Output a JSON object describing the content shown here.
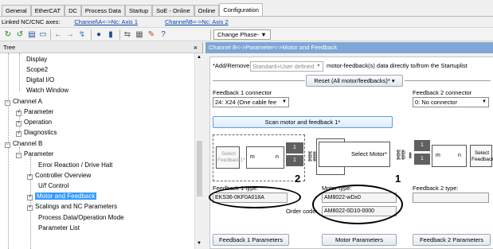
{
  "tabs": [
    "General",
    "EtherCAT",
    "DC",
    "Process Data",
    "Startup",
    "SoE - Online",
    "Online",
    "Configuration"
  ],
  "linked": {
    "label": "Linked NC/CNC axes:",
    "link1": "Channel\\A<->Nc: Axis 1",
    "link2": "Channel\\B<->Nc: Axis 2"
  },
  "toolbar": {
    "phase": "Change Phase-",
    "phase_arrow": "▼"
  },
  "tree": {
    "title": "Tree",
    "close": "×",
    "items": [
      "Display",
      "Scope2",
      "Digital I/O",
      "Watch Window",
      "Channel A",
      "Parameter",
      "Operation",
      "Diagnostics",
      "Channel B",
      "Parameter",
      "Error Reaction / Drive Halt",
      "Controller Overview",
      "U/f Control",
      "Motor and Feedback",
      "Scalings and NC Parameters",
      "Process Data/Operation Mode",
      "Parameter List"
    ],
    "expand": [
      "−",
      "+",
      "+",
      "+",
      "−",
      "−",
      "+",
      "+",
      "+"
    ]
  },
  "panel": {
    "header": "Channel B<->Parameter<->Motor and Feedback",
    "add_remove_label": "*Add/Remove",
    "add_remove_value": "Standard+User defined",
    "add_remove_text": "motor-feedback(s) data directly to/from the Startuplist",
    "reset": "Reset (All motor/feedbacks)*",
    "fb1_label": "Feedback 1 connector",
    "fb1_value": "24: X24 (One cable fee",
    "fb2_label": "Feedback 2 connector",
    "fb2_value": "0: No connector",
    "scan": "Scan motor and feedback 1*",
    "select_fb1": "Select Feedback1*",
    "select_motor": "Select Motor*",
    "select_fb2": "Select Feedback2*",
    "m": "m",
    "n": "n",
    "one": "1",
    "fb1_type_label": "Feedback 1 type:",
    "fb1_type_value": "EKS36-0KF0A018A",
    "motor_type_label": "Motor type:",
    "motor_type_value": "AM8022-wDx0",
    "fb2_type_label": "Feedback 2 type:",
    "order_code_label": "Order code:",
    "order_code_value": "AM8022-0D10-0000",
    "fb1_params": "Feedback 1 Parameters",
    "motor_params": "Motor Parameters",
    "fb2_params": "Feedback 2 Parameters",
    "annot1": "1",
    "annot2": "2"
  },
  "icons": [
    "up-arrow-icon",
    "down-arrow-icon",
    "close-icon"
  ],
  "colors": {
    "selection": "#3399ff",
    "panel_header": "#7fa6d6",
    "link": "#0645ad"
  }
}
